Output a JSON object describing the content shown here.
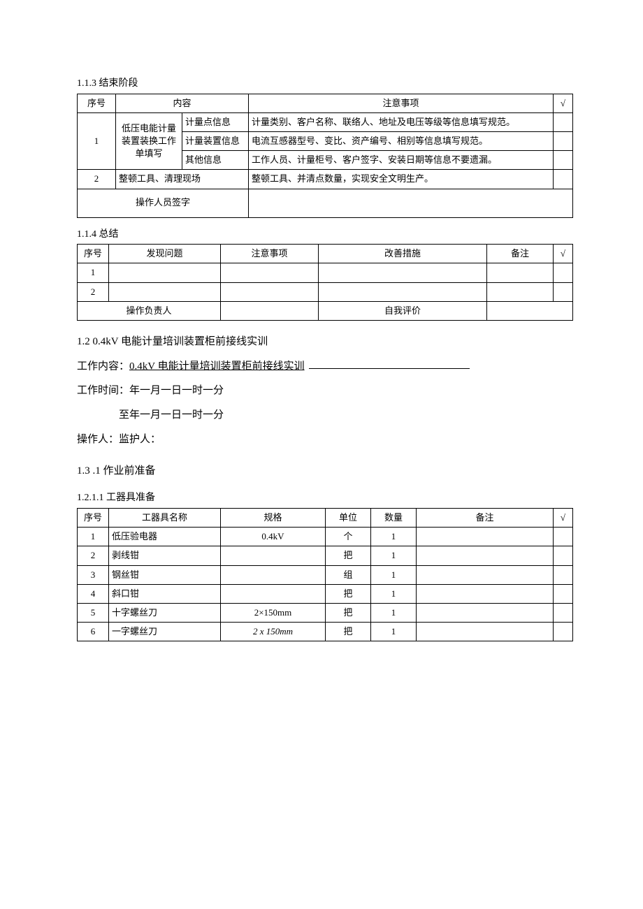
{
  "s113": {
    "title": "1.1.3 结束阶段",
    "head": {
      "no": "序号",
      "content": "内容",
      "note": "注意事项",
      "tick": "√"
    },
    "row1": {
      "no": "1",
      "left": "低压电能计量装置装换工作单填写",
      "sub1": "计量点信息",
      "sub1note": "计量类别、客户名称、联络人、地址及电压等级等信息填写规范。",
      "sub2": "计量装置信息",
      "sub2note": "电流互感器型号、变比、资产编号、相别等信息填写规范。",
      "sub3": "其他信息",
      "sub3note": "工作人员、计量柜号、客户签字、安装日期等信息不要遗漏。"
    },
    "row2": {
      "no": "2",
      "content": "整顿工具、清理现场",
      "note": "整顿工具、并清点数量，实现安全文明生产。"
    },
    "sign": "操作人员签字"
  },
  "s114": {
    "title": "1.1.4 总结",
    "head": {
      "no": "序号",
      "problem": "发现问题",
      "note": "注意事项",
      "improve": "改善措施",
      "remark": "备注",
      "tick": "√"
    },
    "rows": [
      {
        "no": "1"
      },
      {
        "no": "2"
      }
    ],
    "footer": {
      "left": "操作负责人",
      "right": "自我评价"
    }
  },
  "s12_title": "1.2    0.4kV 电能计量培训装置柜前接线实训",
  "work_label": "工作内容：",
  "work_value": "0.4kV 电能计量培训装置柜前接线实训",
  "time_line1": "工作时间：年一月一日一时一分",
  "time_line2": "至年一月一日一时一分",
  "ops_line": "操作人：监护人：",
  "s13_title": "1.3    .1 作业前准备",
  "s1211": {
    "title": "1.2.1.1 工器具准备",
    "head": {
      "no": "序号",
      "name": "工器具名称",
      "spec": "规格",
      "unit": "单位",
      "qty": "数量",
      "remark": "备注",
      "tick": "√"
    },
    "rows": [
      {
        "no": "1",
        "name": "低压验电器",
        "spec": "0.4kV",
        "unit": "个",
        "qty": "1"
      },
      {
        "no": "2",
        "name": "剥线钳",
        "spec": "",
        "unit": "把",
        "qty": "1"
      },
      {
        "no": "3",
        "name": "钢丝钳",
        "spec": "",
        "unit": "组",
        "qty": "1"
      },
      {
        "no": "4",
        "name": "斜口钳",
        "spec": "",
        "unit": "把",
        "qty": "1"
      },
      {
        "no": "5",
        "name": "十字螺丝刀",
        "spec": "2×150mm",
        "unit": "把",
        "qty": "1"
      },
      {
        "no": "6",
        "name": "一字螺丝刀",
        "spec": "2 x 150mm",
        "spec_italic": true,
        "unit": "把",
        "qty": "1"
      }
    ]
  }
}
